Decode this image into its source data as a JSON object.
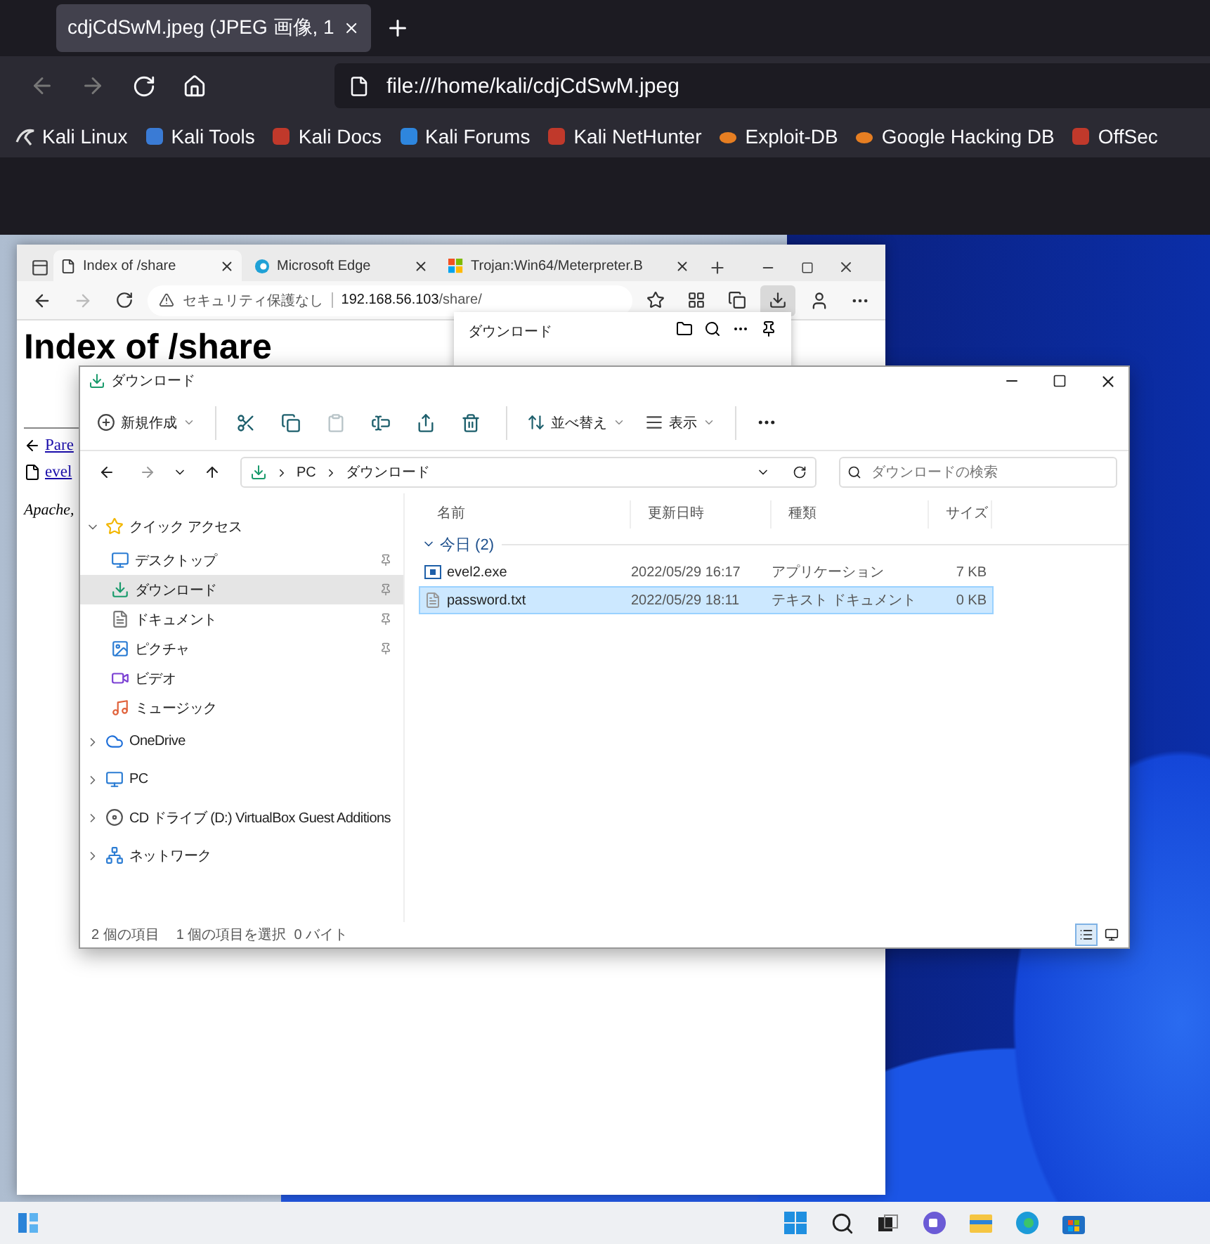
{
  "browser": {
    "tab": {
      "title": "cdjCdSwM.jpeg (JPEG 画像, 1",
      "selected": true
    },
    "url": "file:///home/kali/cdjCdSwM.jpeg",
    "bookmarks": [
      "Kali Linux",
      "Kali Tools",
      "Kali Docs",
      "Kali Forums",
      "Kali NetHunter",
      "Exploit-DB",
      "Google Hacking DB",
      "OffSec"
    ]
  },
  "edge": {
    "tabs": [
      {
        "title": "Index of /share",
        "selected": true
      },
      {
        "title": "Microsoft Edge",
        "selected": false
      },
      {
        "title": "Trojan:Win64/Meterpreter.B",
        "selected": false
      }
    ],
    "security": "セキュリティ保護なし",
    "url_host": "192.168.56.103",
    "url_path": "/share/",
    "downloads_panel": {
      "open": true,
      "title": "ダウンロード"
    },
    "page": {
      "heading": "Index of /share",
      "links": [
        "Pare",
        "evel"
      ],
      "footer": "Apache,"
    }
  },
  "explorer": {
    "title": "ダウンロード",
    "toolbar": {
      "new_label": "新規作成",
      "sort_label": "並べ替え",
      "view_label": "表示",
      "actions": [
        {
          "disabled": false
        },
        {
          "disabled": false
        },
        {
          "disabled": true
        },
        {
          "disabled": false
        },
        {
          "disabled": false
        },
        {
          "disabled": false
        }
      ]
    },
    "breadcrumb": [
      "PC",
      "ダウンロード"
    ],
    "search": {
      "placeholder": "ダウンロードの検索"
    },
    "sidebar": {
      "items": [
        {
          "label": "クイック アクセス",
          "expanded": true,
          "selected": false,
          "children": [
            {
              "label": "デスクトップ",
              "pinned": true,
              "selected": false
            },
            {
              "label": "ダウンロード",
              "pinned": true,
              "selected": true
            },
            {
              "label": "ドキュメント",
              "pinned": true,
              "selected": false
            },
            {
              "label": "ピクチャ",
              "pinned": true,
              "selected": false
            },
            {
              "label": "ビデオ",
              "pinned": false,
              "selected": false
            },
            {
              "label": "ミュージック",
              "pinned": false,
              "selected": false
            }
          ]
        },
        {
          "label": "OneDrive",
          "expanded": false,
          "selected": false
        },
        {
          "label": "PC",
          "expanded": false,
          "selected": false
        },
        {
          "label": "CD ドライブ (D:) VirtualBox Guest Additions",
          "expanded": false,
          "selected": false
        },
        {
          "label": "ネットワーク",
          "expanded": false,
          "selected": false
        }
      ]
    },
    "columns": [
      "名前",
      "更新日時",
      "種類",
      "サイズ"
    ],
    "group": {
      "label": "今日 (2)",
      "expanded": true
    },
    "rows": [
      {
        "name": "evel2.exe",
        "date": "2022/05/29 16:17",
        "type": "アプリケーション",
        "size": "7 KB",
        "selected": false
      },
      {
        "name": "password.txt",
        "date": "2022/05/29 18:11",
        "type": "テキスト ドキュメント",
        "size": "0 KB",
        "selected": true
      }
    ],
    "status": {
      "count": "2 個の項目",
      "selection": "1 個の項目を選択  0 バイト"
    },
    "views": [
      {
        "selected": true
      },
      {
        "selected": false
      }
    ]
  }
}
